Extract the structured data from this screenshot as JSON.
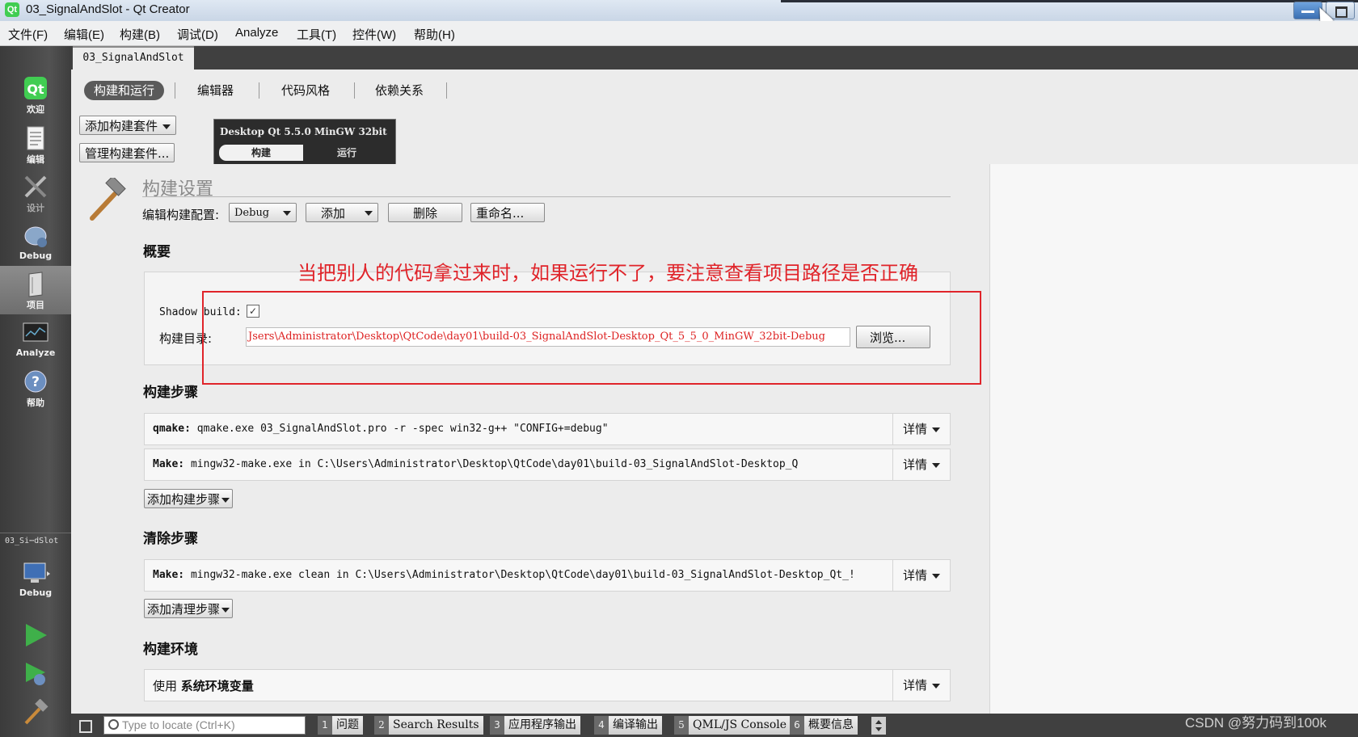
{
  "window": {
    "title": "03_SignalAndSlot - Qt Creator",
    "app_icon_text": "Qt"
  },
  "menubar": [
    "文件(F)",
    "编辑(E)",
    "构建(B)",
    "调试(D)",
    "Analyze",
    "工具(T)",
    "控件(W)",
    "帮助(H)"
  ],
  "modes": [
    {
      "label": "欢迎",
      "icon": "qt-welcome-icon"
    },
    {
      "label": "编辑",
      "icon": "edit-document-icon"
    },
    {
      "label": "设计",
      "icon": "design-tools-icon"
    },
    {
      "label": "Debug",
      "icon": "debug-bug-icon"
    },
    {
      "label": "项目",
      "icon": "project-folder-icon",
      "active": true
    },
    {
      "label": "Analyze",
      "icon": "analyze-monitor-icon"
    },
    {
      "label": "帮助",
      "icon": "help-question-icon"
    }
  ],
  "sidebar": {
    "project_label": "03_Si⋯dSlot",
    "target_label": "Debug"
  },
  "document_tab": "03_SignalAndSlot",
  "subtabs": [
    "构建和运行",
    "编辑器",
    "代码风格",
    "依赖关系"
  ],
  "kits": {
    "add_kit": "添加构建套件",
    "manage_kit": "管理构建套件...",
    "kit_name": "Desktop Qt 5.5.0 MinGW 32bit",
    "build": "构建",
    "run": "运行"
  },
  "build_settings": {
    "title": "构建设置",
    "edit_config_label": "编辑构建配置:",
    "config_value": "Debug",
    "add": "添加",
    "delete": "删除",
    "rename": "重命名...",
    "overview": "概要",
    "shadow_build_label": "Shadow build:",
    "shadow_build_checked": true,
    "build_dir_label": "构建目录:",
    "build_dir_value": "Jsers\\Administrator\\Desktop\\QtCode\\day01\\build-03_SignalAndSlot-Desktop_Qt_5_5_0_MinGW_32bit-Debug",
    "browse": "浏览..."
  },
  "annotation": "当把别人的代码拿过来时，如果运行不了，要注意查看项目路径是否正确",
  "build_steps": {
    "title": "构建步骤",
    "steps": [
      {
        "name": "qmake:",
        "text": "qmake.exe 03_SignalAndSlot.pro -r -spec win32-g++ \"CONFIG+=debug\"",
        "detail": "详情"
      },
      {
        "name": "Make:",
        "text": "mingw32-make.exe in C:\\Users\\Administrator\\Desktop\\QtCode\\day01\\build-03_SignalAndSlot-Desktop_Q",
        "detail": "详情"
      }
    ],
    "add_step": "添加构建步骤"
  },
  "clean_steps": {
    "title": "清除步骤",
    "steps": [
      {
        "name": "Make:",
        "text": "mingw32-make.exe clean in C:\\Users\\Administrator\\Desktop\\QtCode\\day01\\build-03_SignalAndSlot-Desktop_Qt_!",
        "detail": "详情"
      }
    ],
    "add_step": "添加清理步骤"
  },
  "build_env": {
    "title": "构建环境",
    "use": "使用",
    "value": "系统环境变量",
    "detail": "详情"
  },
  "statusbar": {
    "locate_placeholder": "Type to locate (Ctrl+K)",
    "panes": [
      {
        "num": "1",
        "label": "问题"
      },
      {
        "num": "2",
        "label": "Search Results"
      },
      {
        "num": "3",
        "label": "应用程序输出"
      },
      {
        "num": "4",
        "label": "编译输出"
      },
      {
        "num": "5",
        "label": "QML/JS Console"
      },
      {
        "num": "6",
        "label": "概要信息"
      }
    ]
  },
  "watermark": "CSDN @努力码到100k",
  "colors": {
    "annotation": "#e0242a",
    "path_text": "#dd2222",
    "qt_green": "#41cd52"
  }
}
